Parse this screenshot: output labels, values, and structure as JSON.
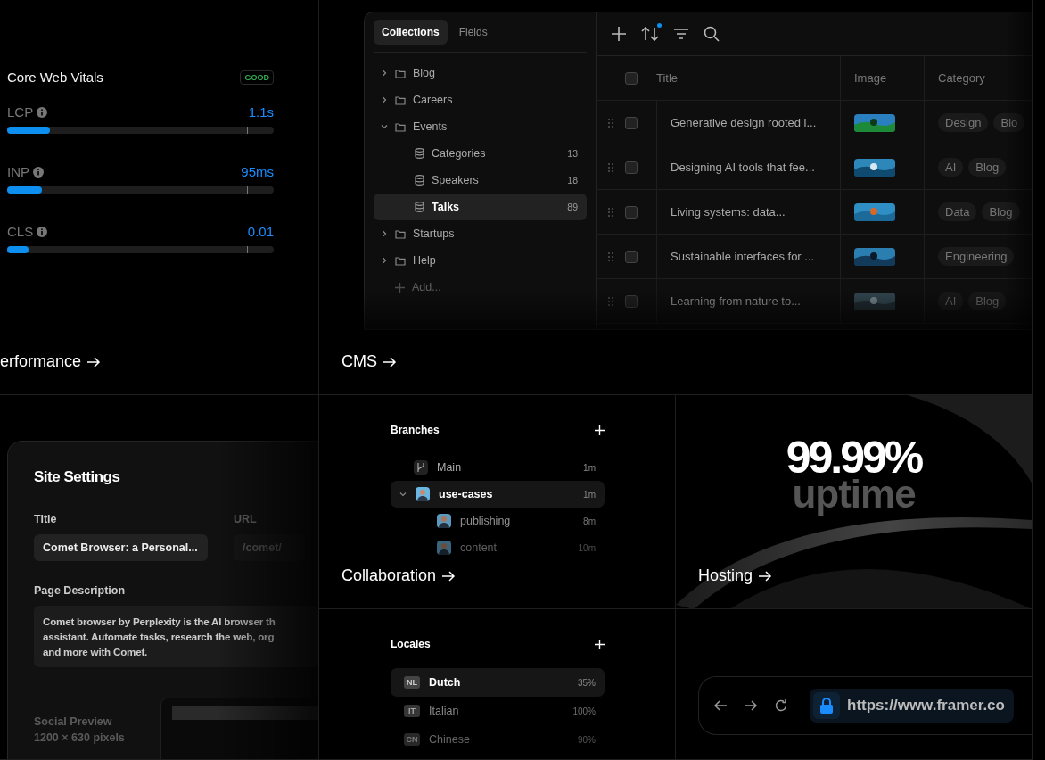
{
  "performance": {
    "title": "Core Web Vitals",
    "badge": "GOOD",
    "metrics": [
      {
        "name": "LCP",
        "value": "1.1s",
        "level": 0.16
      },
      {
        "name": "INP",
        "value": "95ms",
        "level": 0.13
      },
      {
        "name": "CLS",
        "value": "0.01",
        "level": 0.08
      }
    ],
    "link": "erformance"
  },
  "cms": {
    "tabs": [
      {
        "label": "Collections",
        "selected": true
      },
      {
        "label": "Fields",
        "selected": false
      }
    ],
    "toolbar": {
      "sort_badge": true
    },
    "tree": [
      {
        "label": "Blog",
        "expanded": false
      },
      {
        "label": "Careers",
        "expanded": false
      },
      {
        "label": "Events",
        "expanded": true,
        "children": [
          {
            "label": "Categories",
            "count": "13",
            "selected": false
          },
          {
            "label": "Speakers",
            "count": "18",
            "selected": false
          },
          {
            "label": "Talks",
            "count": "89",
            "selected": true
          }
        ]
      },
      {
        "label": "Startups",
        "expanded": false
      },
      {
        "label": "Help",
        "expanded": false
      }
    ],
    "add": "Add...",
    "columns": [
      "Title",
      "Image",
      "Category"
    ],
    "all_checked": false,
    "rows": [
      {
        "title": "Generative design rooted i...",
        "checked": false,
        "image": {
          "kind": "picture"
        },
        "tags": [
          "Design",
          "Blo"
        ]
      },
      {
        "title": "Designing AI tools that fee...",
        "checked": false,
        "image": {
          "kind": "picture"
        },
        "tags": [
          "AI",
          "Blog"
        ]
      },
      {
        "title": "Living systems: data...",
        "checked": false,
        "image": {
          "kind": "picture"
        },
        "tags": [
          "Data",
          "Blog"
        ]
      },
      {
        "title": "Sustainable interfaces for ...",
        "checked": false,
        "image": {
          "kind": "picture"
        },
        "tags": [
          "Engineering"
        ]
      },
      {
        "title": "Learning from nature to...",
        "checked": false,
        "image": {
          "kind": "picture"
        },
        "tags": [
          "AI",
          "Blog"
        ]
      }
    ],
    "link": "CMS"
  },
  "site_settings": {
    "title": "Site Settings",
    "title_label": "Title",
    "title_value": "Comet Browser: a Personal...",
    "url_label": "URL",
    "url_value": "/comet/",
    "description_label": "Page Description",
    "description_lines": [
      "Comet browser by Perplexity is the AI browser th",
      "assistant. Automate tasks, research the web, org",
      "and more with Comet."
    ],
    "social_label": "Social Preview",
    "social_size": "1200 × 630 pixels"
  },
  "collaboration": {
    "title": "Branches",
    "branches": [
      {
        "name": "Main",
        "time": "1m",
        "kind": "main",
        "selected": false
      },
      {
        "name": "use-cases",
        "time": "1m",
        "kind": "user",
        "selected": true,
        "expanded": true,
        "children": [
          {
            "name": "publishing",
            "time": "8m"
          },
          {
            "name": "content",
            "time": "10m"
          }
        ]
      }
    ],
    "link": "Collaboration"
  },
  "hosting": {
    "figure": "99.99%",
    "caption": "uptime",
    "link": "Hosting"
  },
  "locales": {
    "title": "Locales",
    "items": [
      {
        "code": "NL",
        "name": "Dutch",
        "percent": "35%",
        "selected": true
      },
      {
        "code": "IT",
        "name": "Italian",
        "percent": "100%",
        "selected": false
      },
      {
        "code": "CN",
        "name": "Chinese",
        "percent": "90%",
        "selected": false
      }
    ]
  },
  "browser": {
    "url": "https://www.framer.co"
  }
}
